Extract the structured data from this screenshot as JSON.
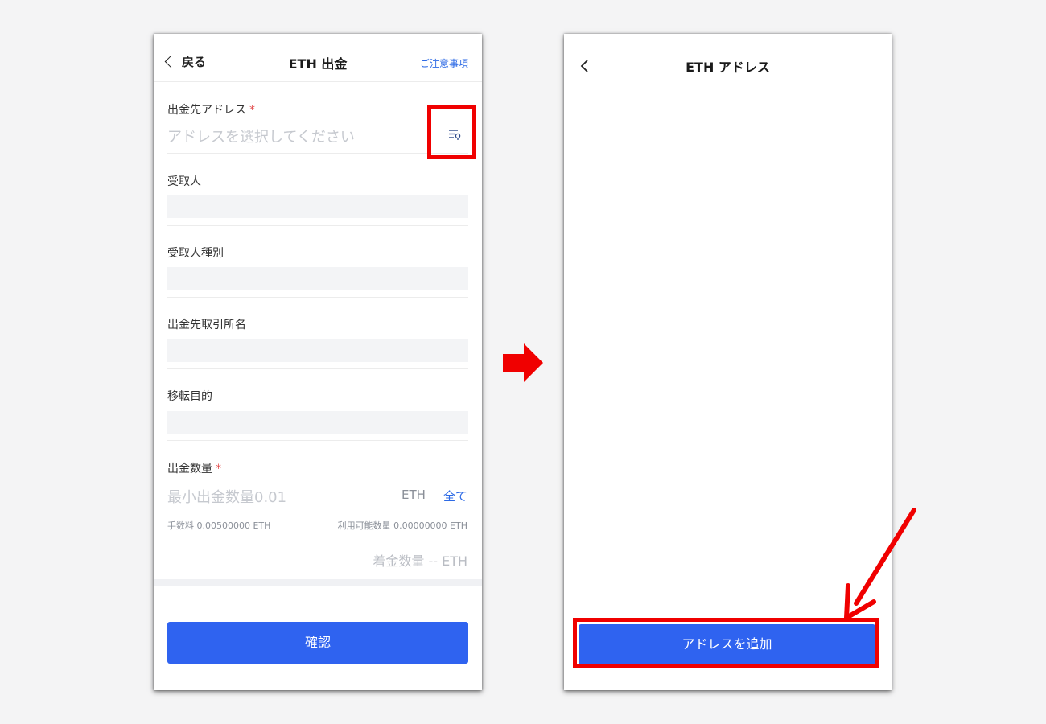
{
  "left_screen": {
    "back_label": "戻る",
    "title": "ETH 出金",
    "notice_link": "ご注意事項",
    "address": {
      "label": "出金先アドレス",
      "required_mark": "*",
      "placeholder": "アドレスを選択してください",
      "icon": "address-book-icon"
    },
    "fields": [
      {
        "label": "受取人"
      },
      {
        "label": "受取人種別"
      },
      {
        "label": "出金先取引所名"
      },
      {
        "label": "移転目的"
      }
    ],
    "amount": {
      "label": "出金数量",
      "required_mark": "*",
      "placeholder": "最小出金数量0.01",
      "unit": "ETH",
      "all_label": "全て",
      "fee_text": "手数料 0.00500000 ETH",
      "available_text": "利用可能数量 0.00000000 ETH",
      "received_text": "着金数量 -- ETH"
    },
    "confirm_label": "確認"
  },
  "right_screen": {
    "title": "ETH アドレス",
    "add_label": "アドレスを追加"
  },
  "colors": {
    "primary": "#2f63f0",
    "link": "#2d6ae5",
    "required": "#e24c4c",
    "annotation": "#f00000"
  }
}
